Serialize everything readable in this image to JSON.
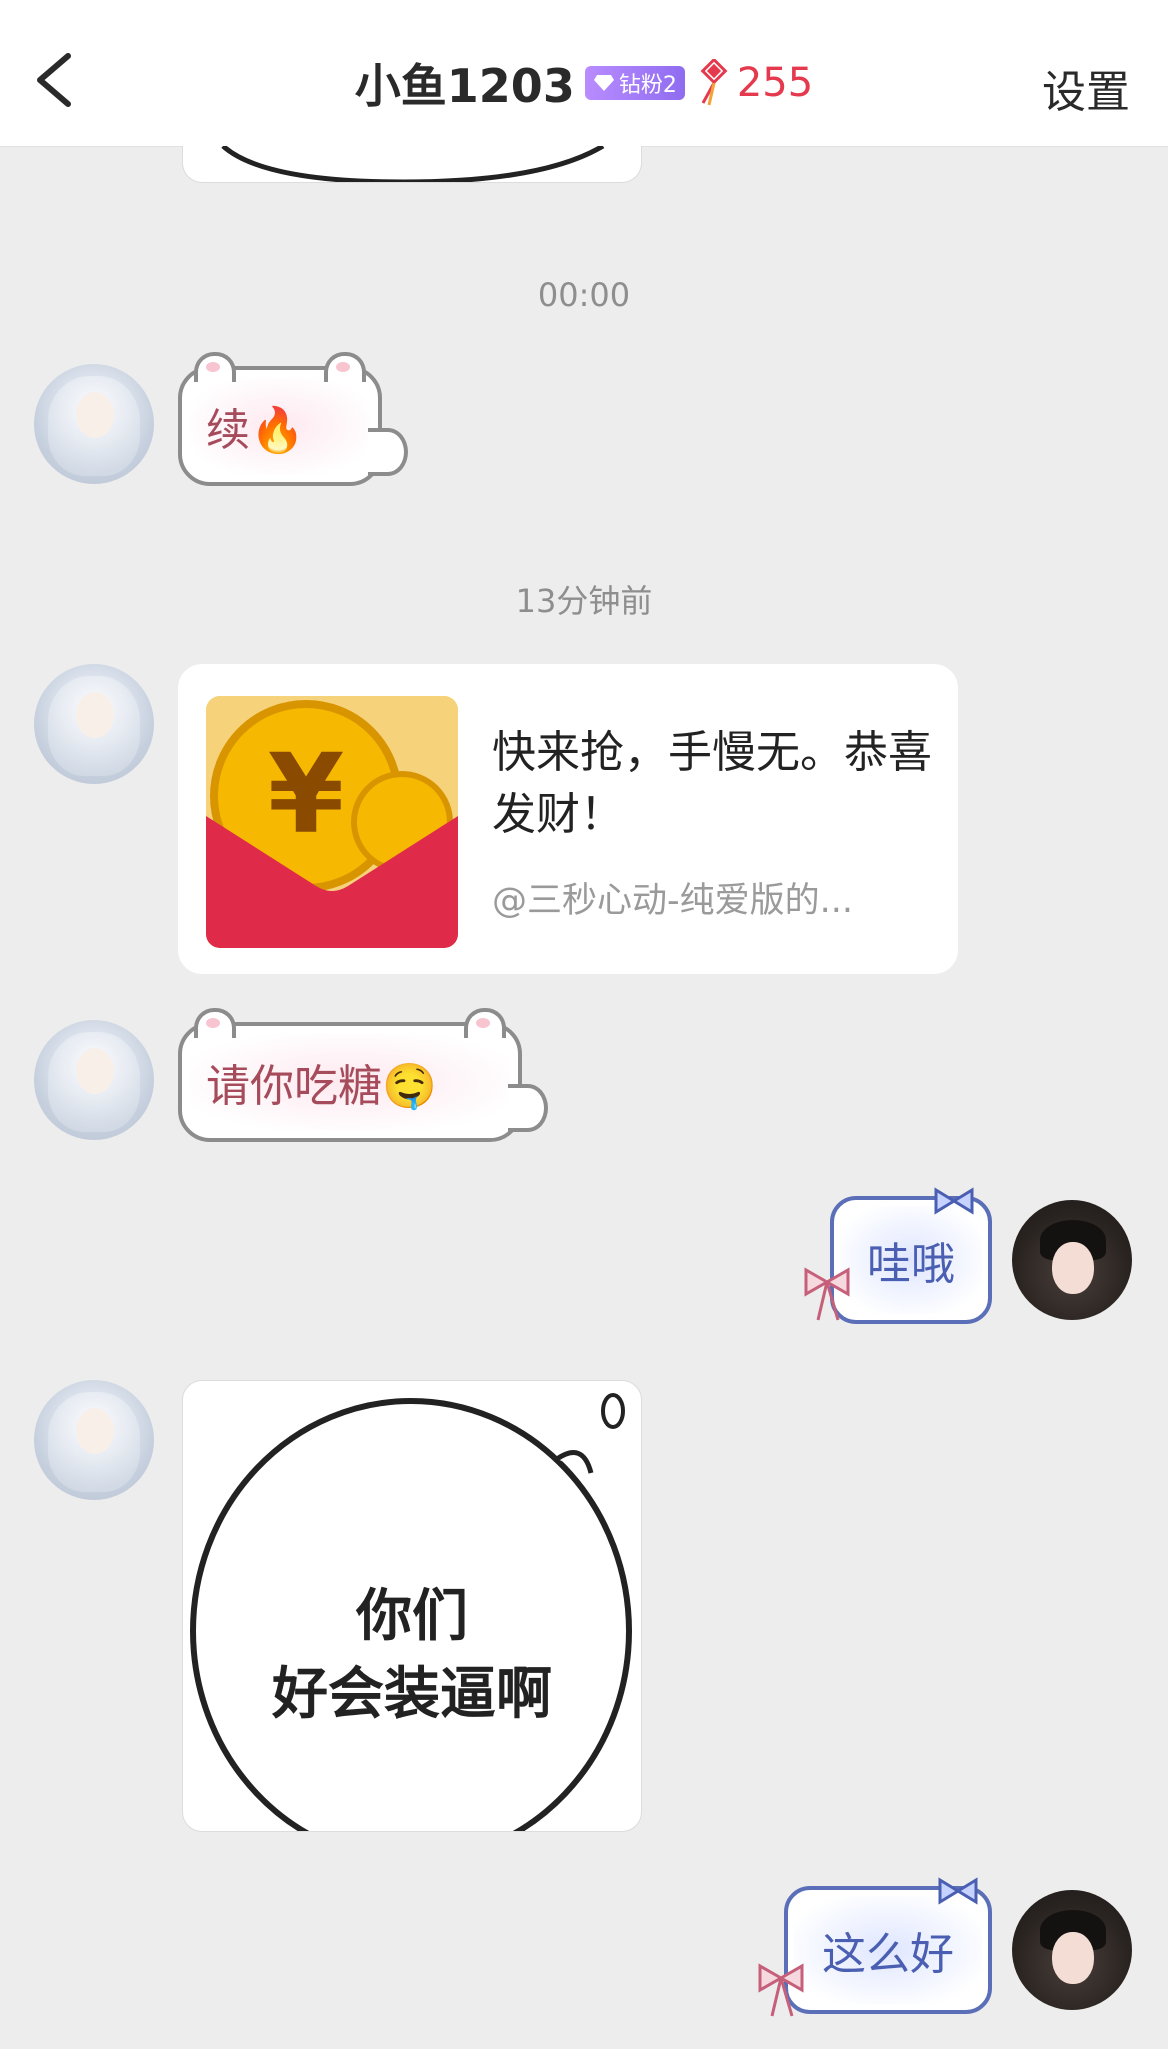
{
  "header": {
    "title": "小鱼1203",
    "fan_badge": "钻粉2",
    "knot_count": "255",
    "settings_label": "设置"
  },
  "colors": {
    "accent_red": "#e5394d",
    "badge_purple": "#9b74f2",
    "bubble_blue": "#5a6fb8",
    "background": "#ededed"
  },
  "messages": [
    {
      "type": "timestamp",
      "text": "00:00"
    },
    {
      "type": "sticker",
      "side": "left",
      "text": "续🔥"
    },
    {
      "type": "timestamp",
      "text": "13分钟前"
    },
    {
      "type": "red_packet",
      "side": "left",
      "text": "快来抢，手慢无。恭喜发财！",
      "sub": "@三秒心动-纯爱版的..."
    },
    {
      "type": "sticker",
      "side": "left",
      "text": "请你吃糖🤤"
    },
    {
      "type": "sticker",
      "side": "right",
      "text": "哇哦"
    },
    {
      "type": "image",
      "side": "left",
      "text_line1": "你们",
      "text_line2": "好会装逼啊"
    },
    {
      "type": "sticker",
      "side": "right",
      "text": "这么好"
    }
  ]
}
